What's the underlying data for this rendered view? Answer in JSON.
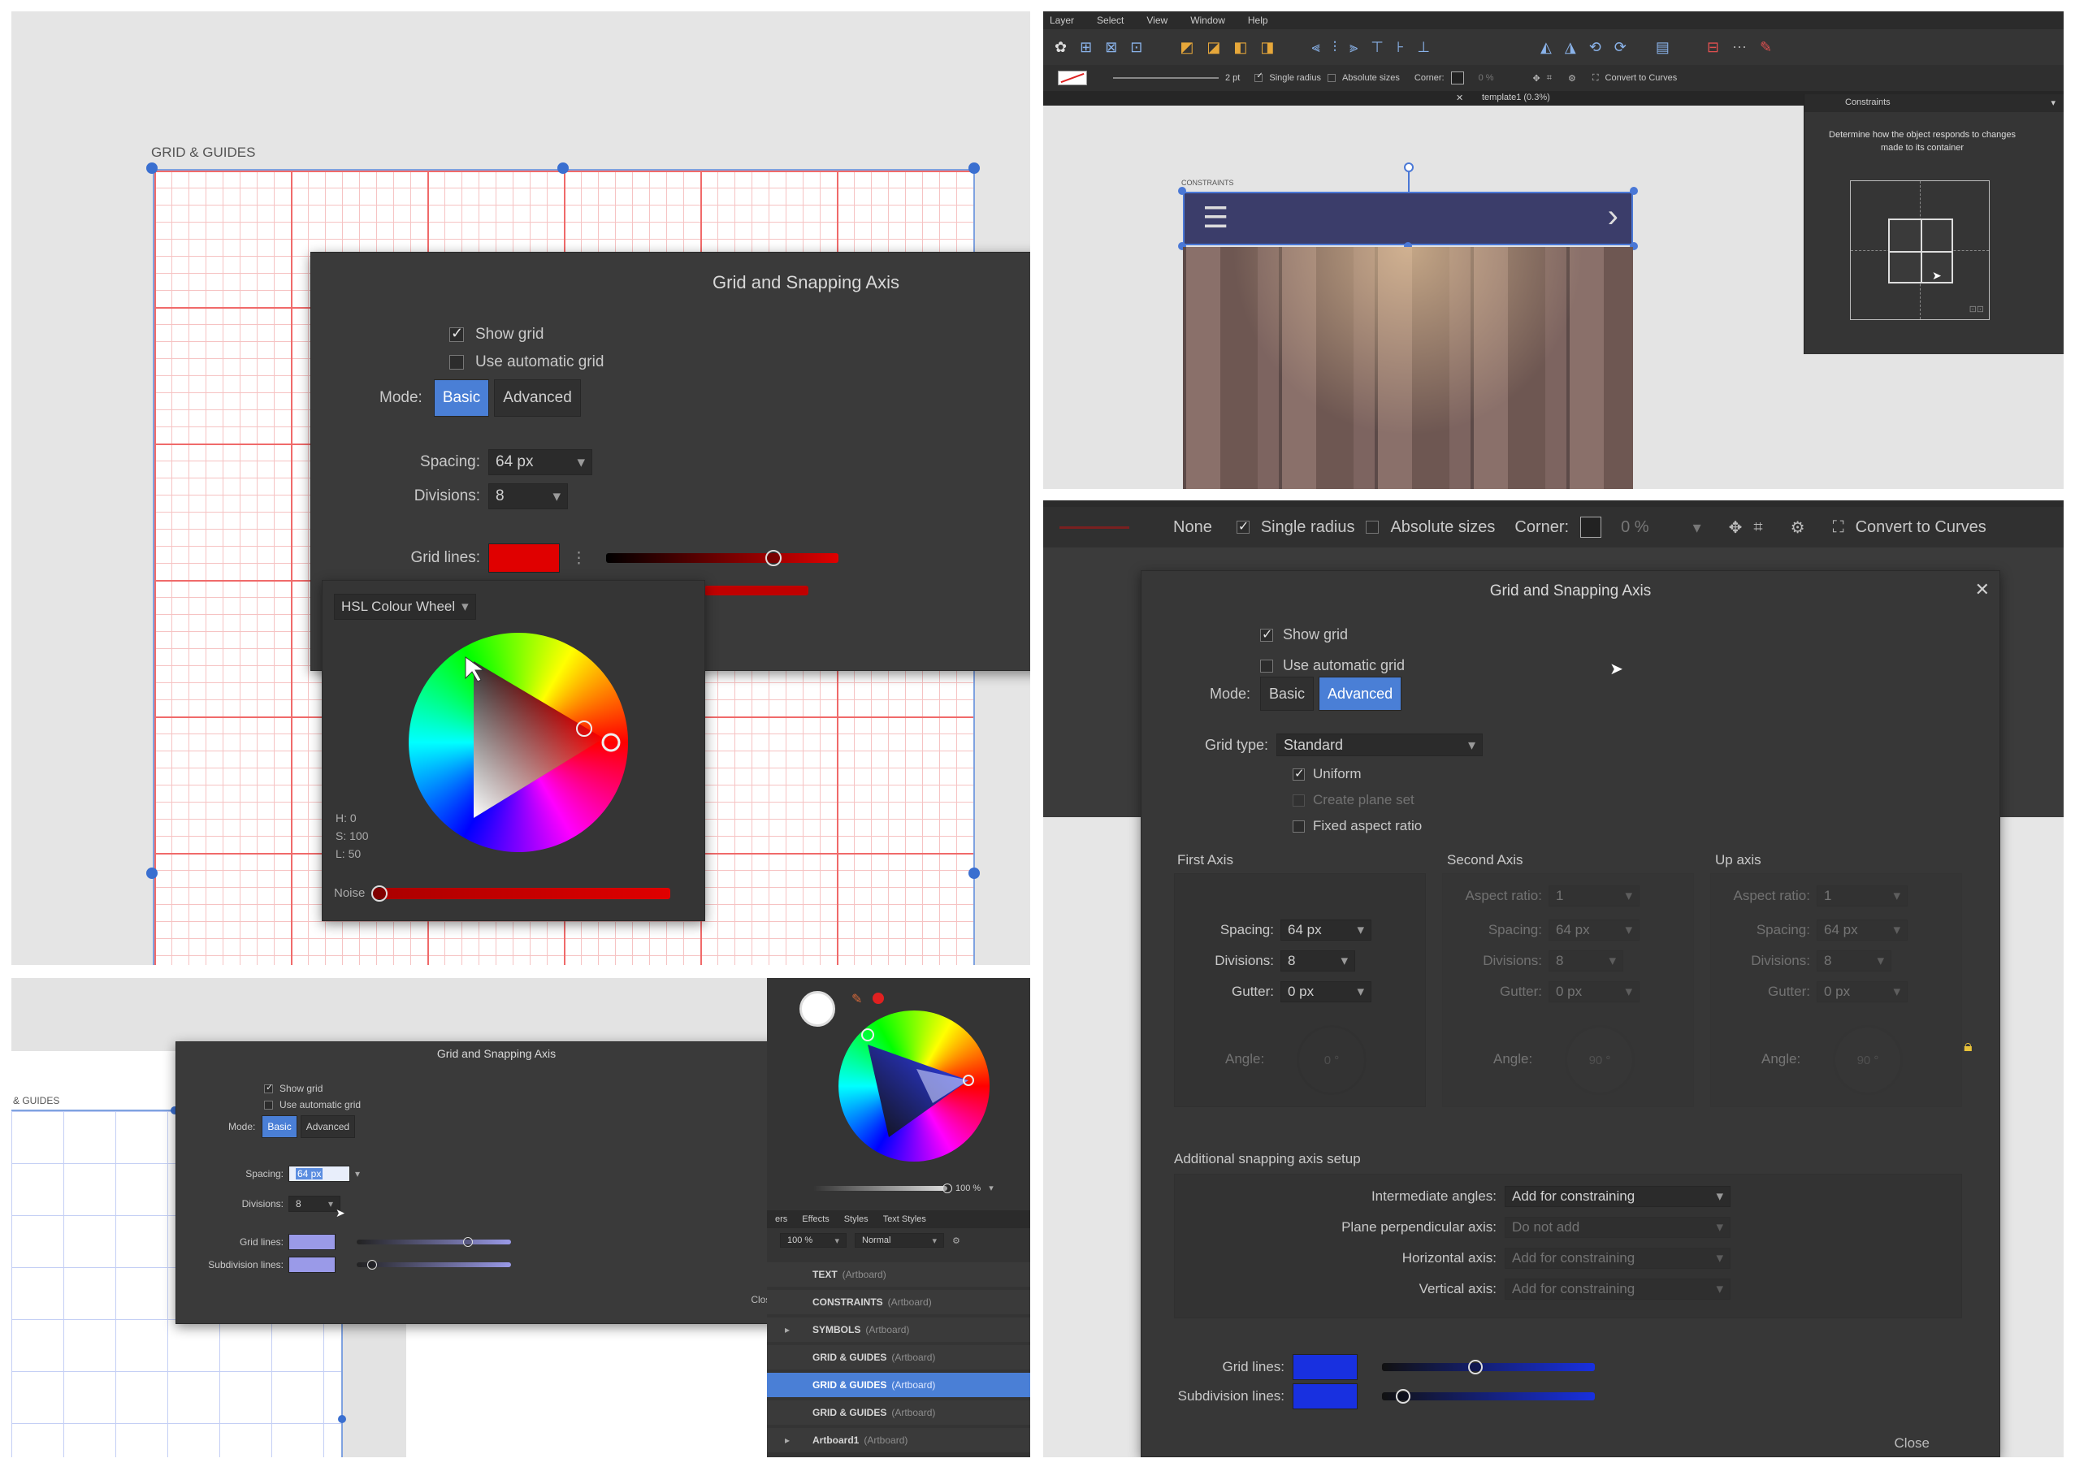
{
  "colors": {
    "dialog_bg": "#3a3a3a",
    "accent": "#4a7fd6",
    "grid_red": "#e00000",
    "lavender": "#9a9ae8",
    "blue": "#1830e0"
  },
  "p1": {
    "artboard_label": "GRID & GUIDES",
    "dialog": {
      "title": "Grid and Snapping Axis",
      "show_grid": "Show grid",
      "auto_grid": "Use automatic grid",
      "mode_label": "Mode:",
      "basic": "Basic",
      "advanced": "Advanced",
      "spacing_label": "Spacing:",
      "spacing_value": "64 px",
      "divisions_label": "Divisions:",
      "divisions_value": "8",
      "grid_lines_label": "Grid lines:"
    },
    "picker": {
      "mode": "HSL Colour Wheel",
      "h": "H: 0",
      "s": "S: 100",
      "l": "L: 50",
      "noise": "Noise"
    }
  },
  "p2": {
    "menu": [
      "Layer",
      "Select",
      "View",
      "Window",
      "Help"
    ],
    "context": {
      "stroke": "2 pt",
      "single_radius": "Single radius",
      "absolute_sizes": "Absolute sizes",
      "corner": "Corner:",
      "percent": "0 %",
      "convert": "Convert to Curves"
    },
    "tab": "template1 (0.3%)",
    "artboard_label": "CONSTRAINTS",
    "constraints": {
      "title": "Constraints",
      "desc": "Determine how the object responds to changes made to its container"
    }
  },
  "p3": {
    "artboard_label": "& GUIDES",
    "dialog": {
      "title": "Grid and Snapping Axis",
      "show_grid": "Show grid",
      "auto_grid": "Use automatic grid",
      "mode_label": "Mode:",
      "basic": "Basic",
      "advanced": "Advanced",
      "spacing_label": "Spacing:",
      "spacing_value": "64 px",
      "divisions_label": "Divisions:",
      "divisions_value": "8",
      "grid_lines_label": "Grid lines:",
      "subdivision_label": "Subdivision lines:",
      "close": "Close"
    },
    "opacity": "100 %",
    "layer_tabs": [
      "ers",
      "Effects",
      "Styles",
      "Text Styles"
    ],
    "layer_opacity": "100 %",
    "blend": "Normal",
    "layers": [
      {
        "name": "TEXT",
        "type": "(Artboard)"
      },
      {
        "name": "CONSTRAINTS",
        "type": "(Artboard)"
      },
      {
        "name": "SYMBOLS",
        "type": "(Artboard)"
      },
      {
        "name": "GRID & GUIDES",
        "type": "(Artboard)"
      },
      {
        "name": "GRID & GUIDES",
        "type": "(Artboard)"
      },
      {
        "name": "GRID & GUIDES",
        "type": "(Artboard)"
      },
      {
        "name": "Artboard1",
        "type": "(Artboard)"
      }
    ]
  },
  "p4": {
    "context": {
      "none": "None",
      "single_radius": "Single radius",
      "absolute_sizes": "Absolute sizes",
      "corner": "Corner:",
      "percent": "0 %",
      "convert": "Convert to Curves"
    },
    "dialog": {
      "title": "Grid and Snapping Axis",
      "show_grid": "Show grid",
      "auto_grid": "Use automatic grid",
      "mode_label": "Mode:",
      "basic": "Basic",
      "advanced": "Advanced",
      "grid_type_label": "Grid type:",
      "grid_type_value": "Standard",
      "uniform": "Uniform",
      "create_plane_set": "Create plane set",
      "fixed_aspect": "Fixed aspect ratio",
      "first_axis": "First Axis",
      "second_axis": "Second Axis",
      "up_axis": "Up axis",
      "aspect_label": "Aspect ratio:",
      "spacing_label": "Spacing:",
      "divisions_label": "Divisions:",
      "gutter_label": "Gutter:",
      "angle_label": "Angle:",
      "first": {
        "spacing": "64 px",
        "divisions": "8",
        "gutter": "0 px",
        "angle": "0 °"
      },
      "second": {
        "aspect": "1",
        "spacing": "64 px",
        "divisions": "8",
        "gutter": "0 px",
        "angle": "90 °"
      },
      "up": {
        "aspect": "1",
        "spacing": "64 px",
        "divisions": "8",
        "gutter": "0 px",
        "angle": "90 °"
      },
      "additional": "Additional snapping axis setup",
      "intermediate_label": "Intermediate angles:",
      "intermediate_value": "Add for constraining",
      "plane_label": "Plane perpendicular axis:",
      "plane_value": "Do not add",
      "horizontal_label": "Horizontal axis:",
      "horizontal_value": "Add for constraining",
      "vertical_label": "Vertical axis:",
      "vertical_value": "Add for constraining",
      "grid_lines_label": "Grid lines:",
      "subdivision_label": "Subdivision lines:",
      "close": "Close"
    }
  }
}
